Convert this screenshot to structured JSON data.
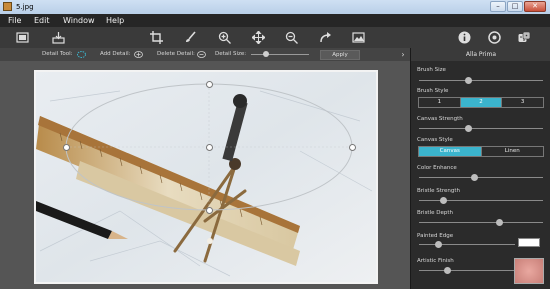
{
  "window": {
    "title": "5.jpg",
    "icons": {
      "minimize": "minimize-icon",
      "maximize": "maximize-icon",
      "close": "close-icon"
    }
  },
  "menu": {
    "items": [
      {
        "label": "File"
      },
      {
        "label": "Edit"
      },
      {
        "label": "Window"
      },
      {
        "label": "Help"
      }
    ]
  },
  "toolbar": {
    "left_icons": [
      "window-icon",
      "save-icon"
    ],
    "center_icons": [
      "crop-icon",
      "brush-icon",
      "zoom-in-icon",
      "move-icon",
      "zoom-out-icon",
      "redo-icon",
      "image-icon"
    ],
    "right_icons": [
      "info-icon",
      "settings-icon",
      "share-icon"
    ]
  },
  "detail": {
    "tool_label": "Detail Tool:",
    "add_label": "Add Detail:",
    "delete_label": "Delete Detail:",
    "size_label": "Detail Size:",
    "size_value": 0.25,
    "apply_label": "Apply"
  },
  "panel": {
    "title": "Alla Prima",
    "brush_size": {
      "label": "Brush Size",
      "value": 0.4
    },
    "brush_style": {
      "label": "Brush Style",
      "options": [
        "1",
        "2",
        "3"
      ],
      "selected": 1
    },
    "canvas_strength": {
      "label": "Canvas Strength",
      "value": 0.4
    },
    "canvas_style": {
      "label": "Canvas Style",
      "options": [
        "Canvas",
        "Linen"
      ],
      "selected": 0
    },
    "color_enhance": {
      "label": "Color Enhance",
      "value": 0.45
    },
    "bristle_strength": {
      "label": "Bristle Strength",
      "value": 0.2
    },
    "bristle_depth": {
      "label": "Bristle Depth",
      "value": 0.65
    },
    "painted_edge": {
      "label": "Painted Edge",
      "value": 0.2
    },
    "artistic_finish": {
      "label": "Artistic Finish",
      "value": 0.3
    }
  },
  "colors": {
    "accent": "#3bb4cd",
    "workspace": "#555555",
    "panel": "#2b2b2b"
  }
}
